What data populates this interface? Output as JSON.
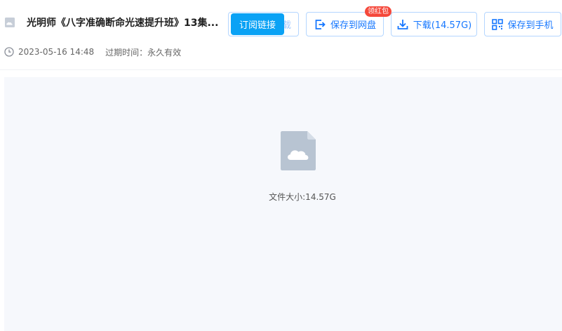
{
  "file": {
    "title": "光明师《八字准确断命光速提升班》13集...",
    "date": "2023-05-16 14:48",
    "expiry_label": "过期时间：",
    "expiry_value": "永久有效",
    "size_text": "文件大小:14.57G"
  },
  "actions": {
    "subscribe_label": "订阅链接",
    "subscribe_hidden_suffix": "载",
    "copy_label": "订阅链接",
    "save_cloud_label": "保存到网盘",
    "save_cloud_badge": "领红包",
    "download_label": "下载(14.57G)",
    "save_phone_label": "保存到手机"
  },
  "colors": {
    "accent": "#1677ff",
    "copy_button": "#0aa2f5",
    "badge": "#f5483b",
    "preview_bg": "#f6f8fc",
    "file_icon": "#b8c4d2"
  },
  "icons": {
    "file_type": "cloud-file-icon",
    "clock": "clock-icon",
    "save_cloud": "save-to-cloud-icon",
    "download": "download-icon",
    "save_phone": "qr-phone-icon"
  }
}
